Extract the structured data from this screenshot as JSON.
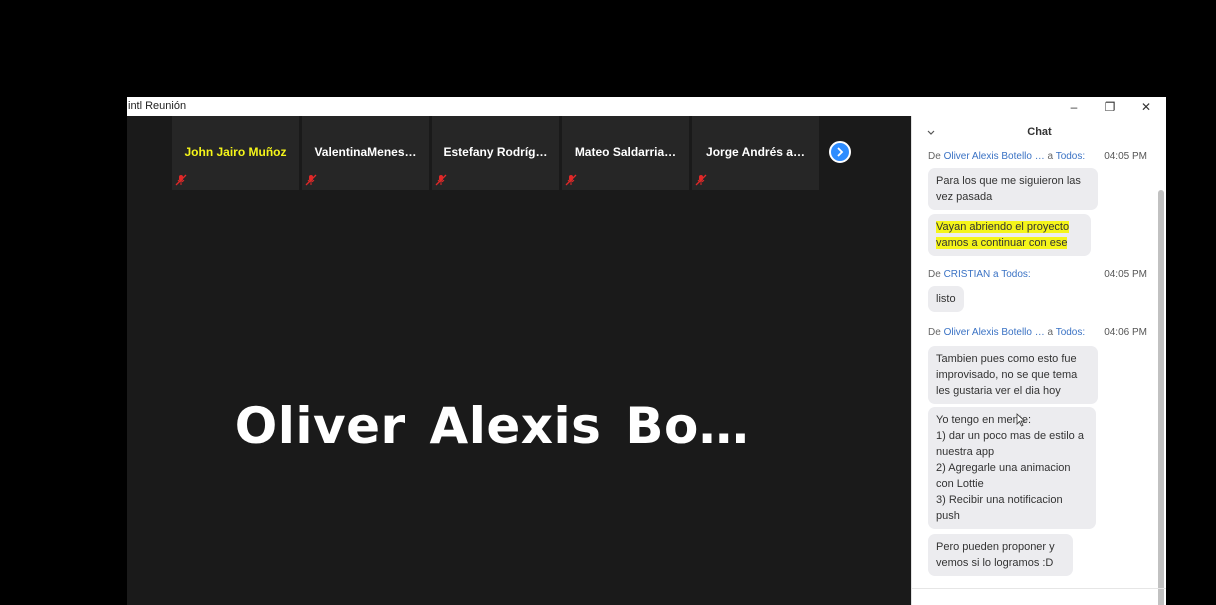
{
  "window": {
    "title": "intl Reunión",
    "controls": {
      "minimize": "–",
      "restore": "❐",
      "close": "✕"
    }
  },
  "participants": [
    {
      "name": "John Jairo Muñoz",
      "highlighted": true,
      "muted": true
    },
    {
      "name": "ValentinaMenes…",
      "highlighted": false,
      "muted": true
    },
    {
      "name": "Estefany Rodríg…",
      "highlighted": false,
      "muted": true
    },
    {
      "name": "Mateo Saldarria…",
      "highlighted": false,
      "muted": true
    },
    {
      "name": "Jorge Andrés a…",
      "highlighted": false,
      "muted": true
    }
  ],
  "active_speaker": "Oliver Alexis Bo…",
  "chat": {
    "title": "Chat",
    "messages": [
      {
        "from_label": "De",
        "sender": "Oliver Alexis Botello …",
        "to_label": "a",
        "recipient": "Todos:",
        "time": "04:05 PM",
        "bubbles": [
          "Para los que me siguieron las vez pasada",
          "Vayan abriendo el proyecto vamos a continuar con ese"
        ]
      },
      {
        "from_label": "De",
        "sender": "CRISTIAN",
        "to_label": "a",
        "recipient": "Todos:",
        "time": "04:05 PM",
        "bubbles": [
          "listo"
        ]
      },
      {
        "from_label": "De",
        "sender": "Oliver Alexis Botello …",
        "to_label": "a",
        "recipient": "Todos:",
        "time": "04:06 PM",
        "bubbles": [
          "Tambien pues como esto fue improvisado, no se que tema les gustaria ver el dia hoy",
          "Yo tengo en mente:\n1) dar un poco mas de estilo a nuestra app\n2) Agregarle una animacion con Lottie\n3) Recibir una notificacion push",
          "Pero pueden proponer y vemos si lo logramos :D"
        ]
      }
    ]
  },
  "colors": {
    "accent": "#2d8cff",
    "highlight": "#f5f51a",
    "meeting_bg": "#1a1a1a",
    "tile_bg": "#262626",
    "mute_red": "#e02828"
  }
}
